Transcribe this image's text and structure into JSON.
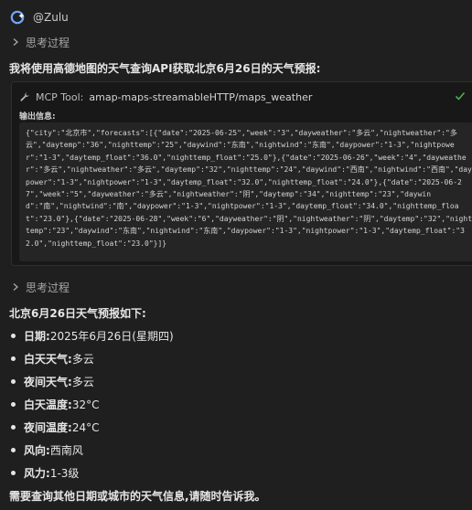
{
  "header": {
    "user_name": "@Zulu",
    "avatar_icon": "copilot-avatar-icon"
  },
  "thinking_label_1": "思考过程",
  "intro": "我将使用高德地图的天气查询API获取北京6月26日的天气预报:",
  "tool": {
    "title": "MCP Tool:",
    "name": "amap-maps-streamableHTTP/maps_weather",
    "output_label": "输出信息:",
    "output": "{\"city\":\"北京市\",\"forecasts\":[{\"date\":\"2025-06-25\",\"week\":\"3\",\"dayweather\":\"多云\",\"nightweather\":\"多云\",\"daytemp\":\"36\",\"nighttemp\":\"25\",\"daywind\":\"东南\",\"nightwind\":\"东南\",\"daypower\":\"1-3\",\"nightpower\":\"1-3\",\"daytemp_float\":\"36.0\",\"nighttemp_float\":\"25.0\"},{\"date\":\"2025-06-26\",\"week\":\"4\",\"dayweather\":\"多云\",\"nightweather\":\"多云\",\"daytemp\":\"32\",\"nighttemp\":\"24\",\"daywind\":\"西南\",\"nightwind\":\"西南\",\"daypower\":\"1-3\",\"nightpower\":\"1-3\",\"daytemp_float\":\"32.0\",\"nighttemp_float\":\"24.0\"},{\"date\":\"2025-06-27\",\"week\":\"5\",\"dayweather\":\"多云\",\"nightweather\":\"阴\",\"daytemp\":\"34\",\"nighttemp\":\"23\",\"daywind\":\"南\",\"nightwind\":\"南\",\"daypower\":\"1-3\",\"nightpower\":\"1-3\",\"daytemp_float\":\"34.0\",\"nighttemp_float\":\"23.0\"},{\"date\":\"2025-06-28\",\"week\":\"6\",\"dayweather\":\"阴\",\"nightweather\":\"阴\",\"daytemp\":\"32\",\"nighttemp\":\"23\",\"daywind\":\"东南\",\"nightwind\":\"东南\",\"daypower\":\"1-3\",\"nightpower\":\"1-3\",\"daytemp_float\":\"32.0\",\"nighttemp_float\":\"23.0\"}]}"
  },
  "thinking_label_2": "思考过程",
  "result": {
    "title": "北京6月26日天气预报如下:",
    "items": [
      {
        "label": "日期",
        "sep": ":",
        "value": "2025年6月26日(星期四)"
      },
      {
        "label": "白天天气",
        "sep": ":",
        "value": "多云"
      },
      {
        "label": "夜间天气",
        "sep": ":",
        "value": "多云"
      },
      {
        "label": "白天温度",
        "sep": ":",
        "value": "32°C"
      },
      {
        "label": "夜间温度",
        "sep": ":",
        "value": "24°C"
      },
      {
        "label": "风向",
        "sep": ":",
        "value": "西南风"
      },
      {
        "label": "风力",
        "sep": ":",
        "value": "1-3级"
      }
    ]
  },
  "footer": "需要查询其他日期或城市的天气信息,请随时告诉我。",
  "colors": {
    "background": "#1f1f1f",
    "code_background": "#252526",
    "check": "#4caf50",
    "avatar": "#6fa8ff"
  }
}
